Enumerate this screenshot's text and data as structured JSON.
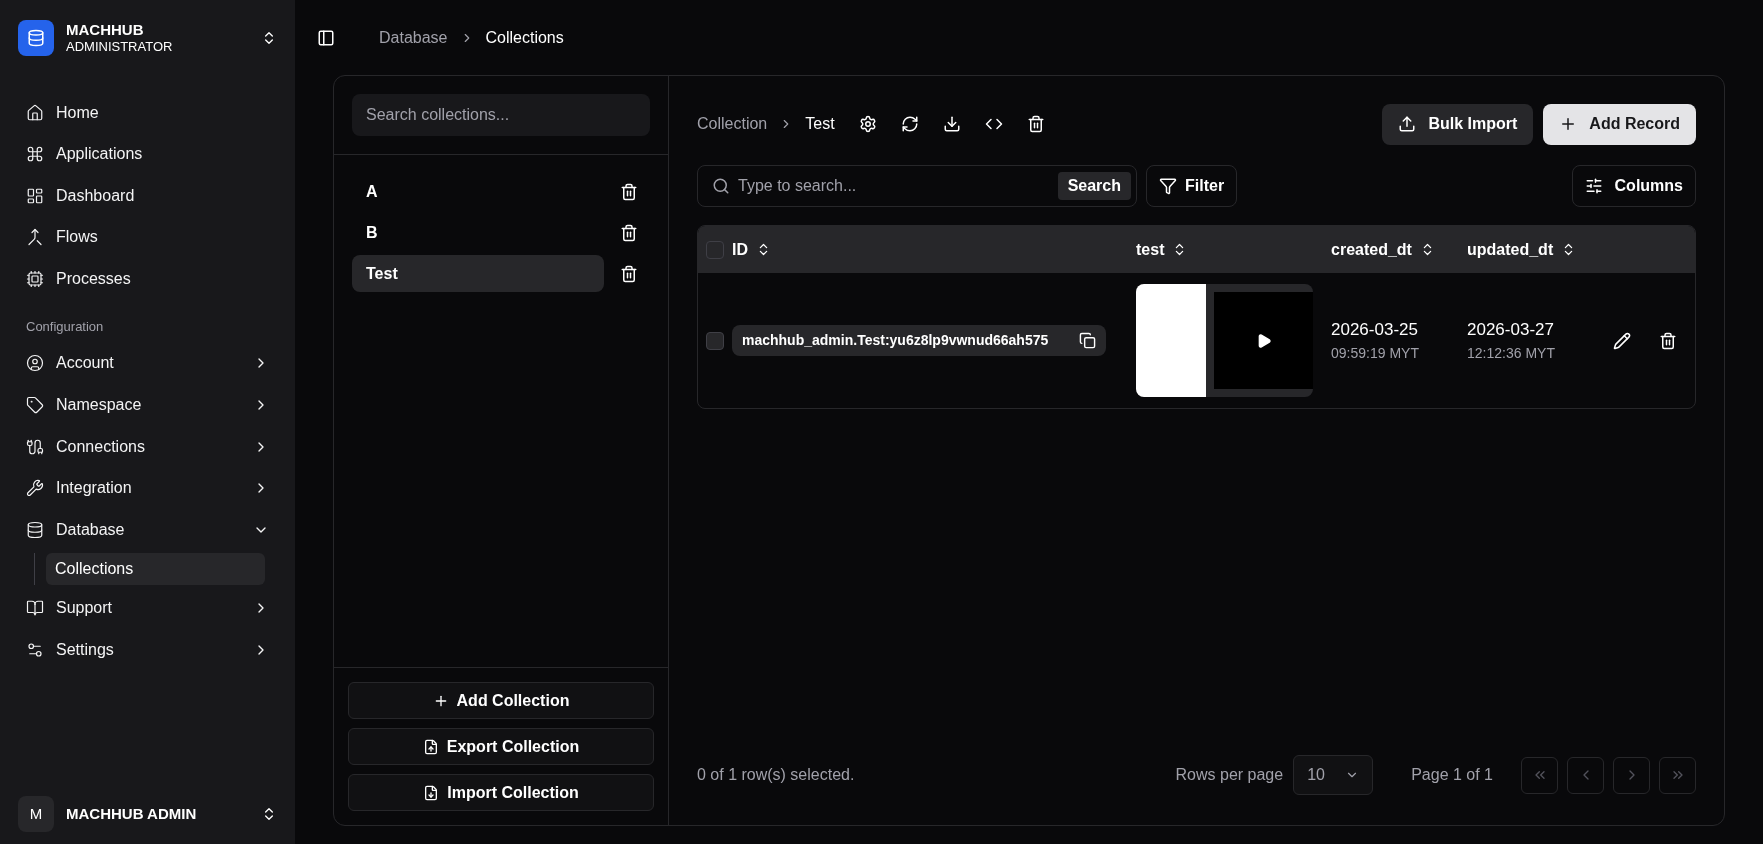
{
  "sidebar": {
    "brand": {
      "title": "MACHHUB",
      "subtitle": "ADMINISTRATOR"
    },
    "items": [
      {
        "label": "Home"
      },
      {
        "label": "Applications"
      },
      {
        "label": "Dashboard"
      },
      {
        "label": "Flows"
      },
      {
        "label": "Processes"
      }
    ],
    "section_label": "Configuration",
    "config_items": [
      {
        "label": "Account",
        "kind": "group",
        "expanded": false
      },
      {
        "label": "Namespace",
        "kind": "group",
        "expanded": false
      },
      {
        "label": "Connections",
        "kind": "group",
        "expanded": false
      },
      {
        "label": "Integration",
        "kind": "group",
        "expanded": false
      },
      {
        "label": "Database",
        "kind": "group",
        "expanded": true,
        "children": [
          {
            "label": "Collections",
            "selected": true
          }
        ]
      },
      {
        "label": "Support",
        "kind": "group",
        "expanded": false
      },
      {
        "label": "Settings",
        "kind": "group",
        "expanded": false
      }
    ],
    "user": {
      "initial": "M",
      "name": "MACHHUB ADMIN"
    }
  },
  "breadcrumb": [
    "Database",
    "Collections"
  ],
  "collections_panel": {
    "search": {
      "placeholder": "Search collections..."
    },
    "items": [
      {
        "label": "A",
        "selected": false
      },
      {
        "label": "B",
        "selected": false
      },
      {
        "label": "Test",
        "selected": true
      }
    ],
    "buttons": [
      "Add Collection",
      "Export Collection",
      "Import Collection"
    ]
  },
  "records": {
    "breadcrumb": [
      "Collection",
      "Test"
    ],
    "buttons": {
      "bulk_import": "Bulk Import",
      "add_record": "Add Record"
    },
    "search": {
      "placeholder": "Type to search...",
      "button": "Search"
    },
    "filter": "Filter",
    "columns_button": "Columns",
    "table": {
      "header_checked": false,
      "columns": [
        "ID",
        "test",
        "created_dt",
        "updated_dt"
      ],
      "rows": [
        {
          "checked": false,
          "id": "machhub_admin.Test:yu6z8lp9vwnud66ah575",
          "created_date": "2026-03-25",
          "created_time": "09:59:19 MYT",
          "updated_date": "2026-03-27",
          "updated_time": "12:12:36 MYT"
        }
      ]
    },
    "footer": {
      "selection": "0 of 1 row(s) selected.",
      "rows_per_page_label": "Rows per page",
      "rows_per_page": "10",
      "page": "Page 1 of 1",
      "pager": [
        {
          "kind": "first",
          "disabled": true
        },
        {
          "kind": "prev",
          "disabled": true
        },
        {
          "kind": "next",
          "disabled": true
        },
        {
          "kind": "last",
          "disabled": true
        }
      ]
    }
  }
}
